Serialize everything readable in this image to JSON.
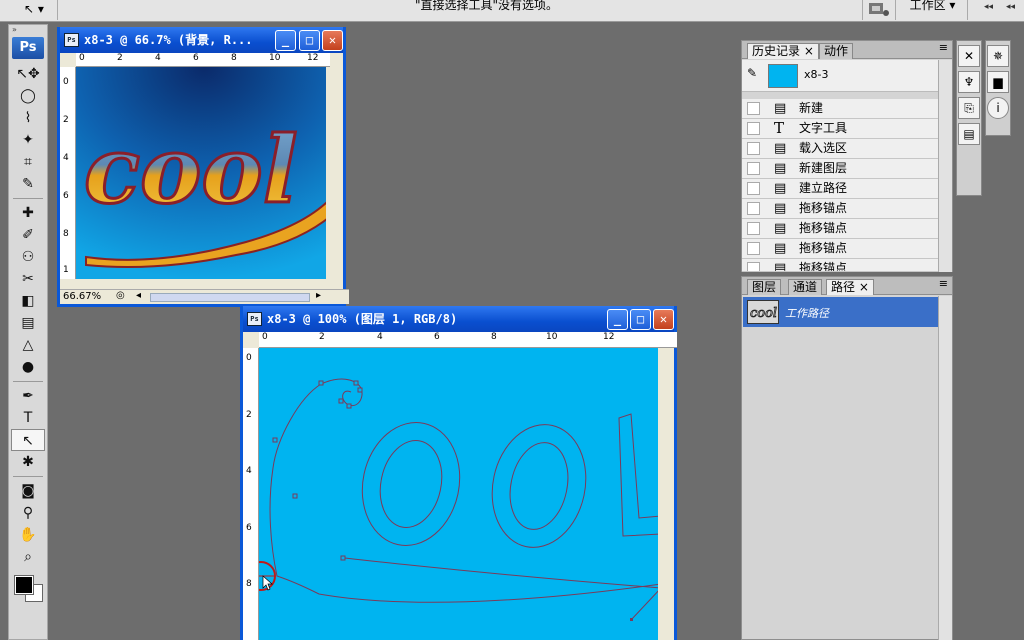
{
  "options_bar": {
    "tool_arrow": "↖ ▾",
    "hint": "\"直接选择工具\"没有选项。",
    "workspace": "工作区 ▾"
  },
  "toolbox": {
    "logo": "Ps",
    "tools": [
      "↖✥",
      "◯",
      "⌇",
      "✦",
      "⌗",
      "✎",
      "✚",
      "✐",
      "⚇",
      "✂",
      "◧",
      "▤",
      "△",
      "●",
      "✒",
      "T",
      "↖",
      "✱",
      "◙",
      "⚲",
      "✋",
      "⌕"
    ]
  },
  "window1": {
    "title": "x8-3 @ 66.7% (背景, R...",
    "zoom": "66.67%",
    "ruler_h": [
      "0",
      "2",
      "4",
      "6",
      "8",
      "10",
      "12"
    ],
    "ruler_v": [
      "0",
      "2",
      "4",
      "6",
      "8",
      "1"
    ]
  },
  "window2": {
    "title": "x8-3 @ 100% (图层 1, RGB/8)",
    "ruler_h": [
      "0",
      "2",
      "4",
      "6",
      "8",
      "10",
      "12"
    ],
    "ruler_v": [
      "0",
      "2",
      "4",
      "6",
      "8"
    ]
  },
  "history_panel": {
    "tabs": [
      "历史记录",
      "动作"
    ],
    "snapshot_label": "x8-3",
    "steps": [
      {
        "icon": "doc",
        "label": "新建"
      },
      {
        "icon": "T",
        "label": "文字工具"
      },
      {
        "icon": "doc",
        "label": "载入选区"
      },
      {
        "icon": "doc",
        "label": "新建图层"
      },
      {
        "icon": "doc",
        "label": "建立路径"
      },
      {
        "icon": "doc",
        "label": "拖移锚点"
      },
      {
        "icon": "doc",
        "label": "拖移锚点"
      },
      {
        "icon": "doc",
        "label": "拖移锚点"
      },
      {
        "icon": "doc",
        "label": "拖移锚点"
      }
    ]
  },
  "layers_panel": {
    "tabs": [
      "图层",
      "通道",
      "路径"
    ],
    "path_name": "工作路径"
  },
  "colors": {
    "canvas_blue": "#00b4f0",
    "path_stroke": "#7a3a5a",
    "selection_blue": "#3a6fc8",
    "title_blue": "#0a4fd0"
  }
}
